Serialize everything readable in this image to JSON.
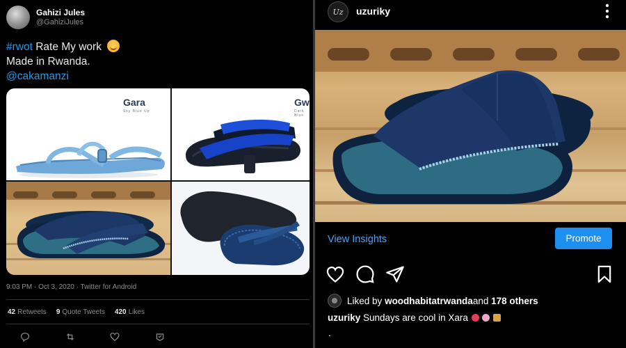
{
  "tweet": {
    "author_name": "Gahizi Jules",
    "author_handle": "@GahiziJules",
    "hashtag": "#rwot",
    "text_line1": " Rate My work",
    "text_line2": "Made in Rwanda.",
    "mention": "@cakamanzi",
    "photos": [
      {
        "brand": "Gara",
        "brand_sub": "Sky Blue Up"
      },
      {
        "brand": "Gwi",
        "brand_sub": "Dark Blue"
      },
      {
        "brand": "",
        "brand_sub": ""
      },
      {
        "brand": "",
        "brand_sub": ""
      }
    ],
    "meta": "9:03 PM · Oct 3, 2020 · Twitter for Android",
    "retweets_count": "42",
    "retweets_label": "Retweets",
    "quotes_count": "9",
    "quotes_label": "Quote Tweets",
    "likes_count": "420",
    "likes_label": "Likes",
    "actions": [
      "reply-icon",
      "retweet-icon",
      "like-icon",
      "share-icon"
    ]
  },
  "instagram": {
    "username": "uzuriky",
    "avatar_text": "Uz",
    "view_insights": "View Insights",
    "promote": "Promote",
    "liked_prefix": "Liked by ",
    "liked_user": "woodhabitatrwanda",
    "liked_mid": " and ",
    "liked_others": "178 others",
    "caption_user": "uzuriky",
    "caption_text": " Sundays are cool in Xara",
    "caption_dot": ".",
    "actions": [
      "heart-icon",
      "comment-icon",
      "send-icon",
      "bookmark-icon"
    ]
  },
  "colors": {
    "twitter_link": "#1d9bf0",
    "ig_link": "#4aa3f5",
    "ig_button": "#1d8ff0",
    "denim": "#1e3a6a"
  }
}
